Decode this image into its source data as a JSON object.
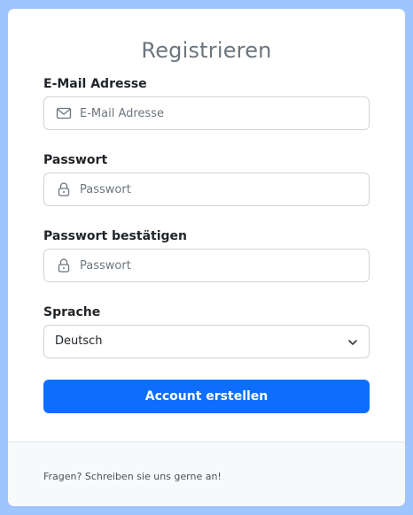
{
  "form": {
    "title": "Registrieren",
    "email": {
      "label": "E-Mail Adresse",
      "placeholder": "E-Mail Adresse",
      "icon": "envelope-icon"
    },
    "password": {
      "label": "Passwort",
      "placeholder": "Passwort",
      "icon": "lock-icon"
    },
    "password_confirm": {
      "label": "Passwort bestätigen",
      "placeholder": "Passwort",
      "icon": "lock-icon"
    },
    "language": {
      "label": "Sprache",
      "selected": "Deutsch"
    },
    "submit_label": "Account erstellen"
  },
  "footer": {
    "text": "Fragen? Schreiben sie uns gerne an!"
  },
  "colors": {
    "page_background": "#9ec5fe",
    "primary": "#0d6efd",
    "muted_text": "#6c757d"
  }
}
